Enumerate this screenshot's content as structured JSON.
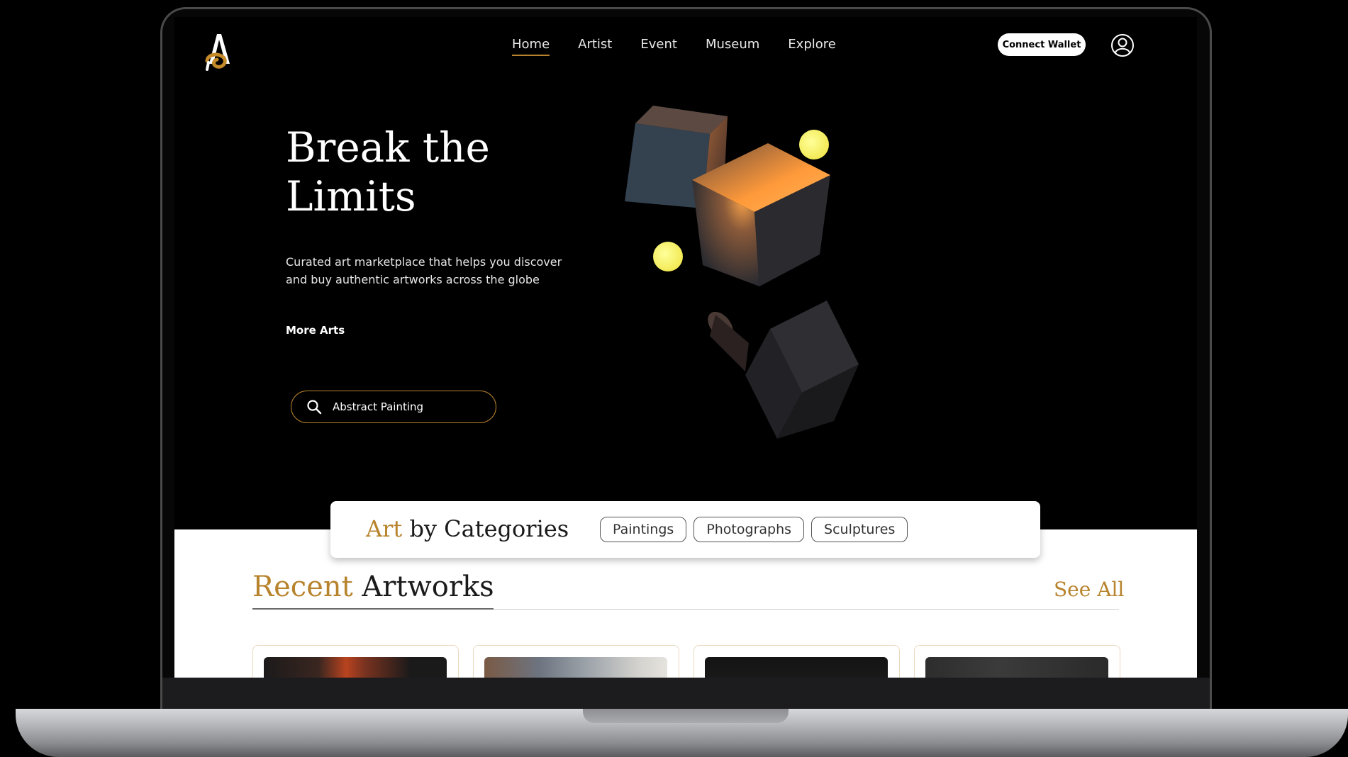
{
  "nav": {
    "items": [
      {
        "label": "Home",
        "active": true
      },
      {
        "label": "Artist",
        "active": false
      },
      {
        "label": "Event",
        "active": false
      },
      {
        "label": "Museum",
        "active": false
      },
      {
        "label": "Explore",
        "active": false
      }
    ],
    "connect_wallet_label": "Connect Wallet",
    "user_icon": "user-circle-icon",
    "logo_icon": "letter-a-logo-icon"
  },
  "hero": {
    "title_line1": "Break the",
    "title_line2": "Limits",
    "subtitle_line1": "Curated art marketplace that helps you discover",
    "subtitle_line2": "and buy authentic artworks across the globe",
    "more_arts_label": "More Arts",
    "search_value": "Abstract Painting",
    "search_icon": "search-icon"
  },
  "categories": {
    "title_accent": "Art",
    "title_rest": " by Categories",
    "tabs": [
      {
        "label": "Paintings"
      },
      {
        "label": "Photographs"
      },
      {
        "label": "Sculptures"
      }
    ]
  },
  "recent": {
    "title_accent": "Recent",
    "title_rest": " Artworks",
    "see_all_label": "See All"
  },
  "colors": {
    "accent_gold": "#b7832c",
    "background": "#000000",
    "sphere_yellow": "#f4ee6a"
  }
}
